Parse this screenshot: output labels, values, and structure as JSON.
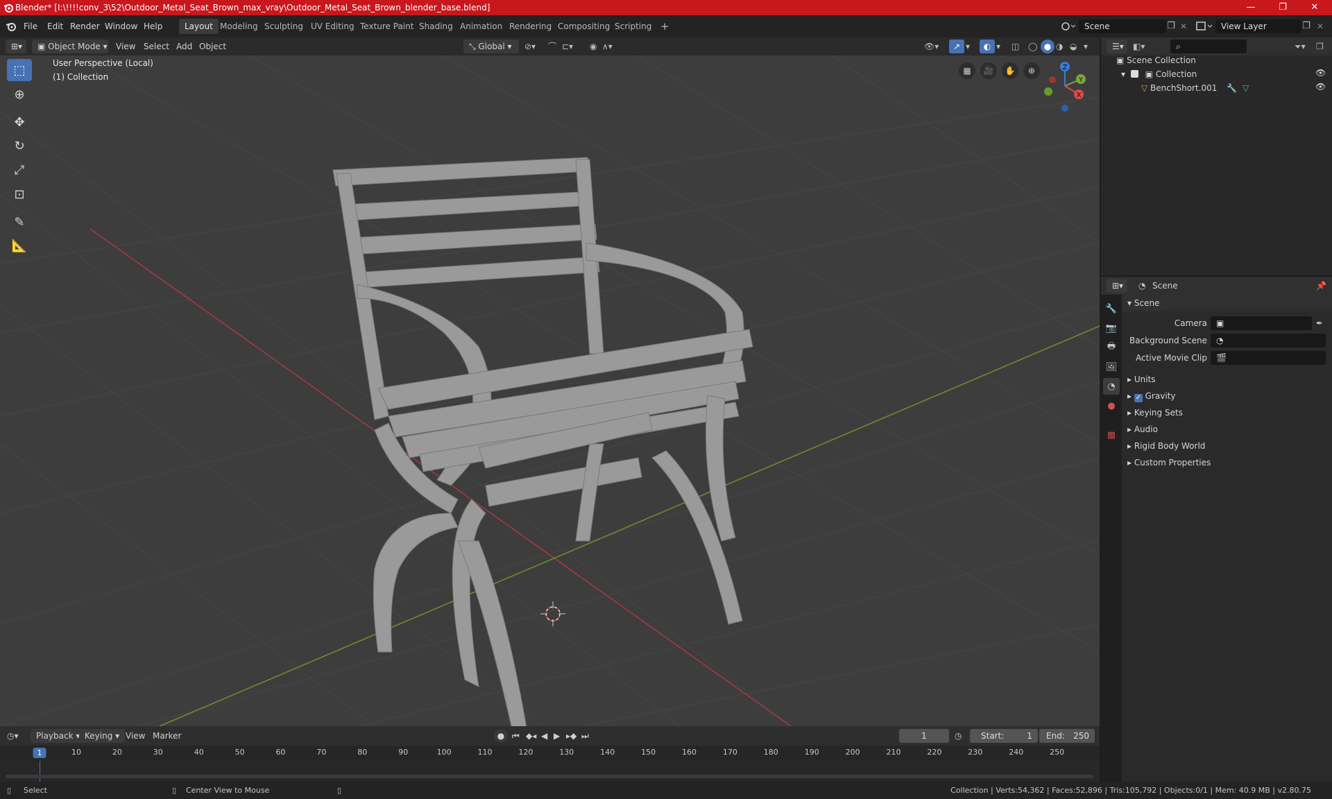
{
  "window": {
    "title": "Blender* [I:\\!!!!conv_3\\52\\Outdoor_Metal_Seat_Brown_max_vray\\Outdoor_Metal_Seat_Brown_blender_base.blend]",
    "minimize": "—",
    "maximize": "❐",
    "close": "✕"
  },
  "menu": [
    "File",
    "Edit",
    "Render",
    "Window",
    "Help"
  ],
  "workspaces": [
    "Layout",
    "Modeling",
    "Sculpting",
    "UV Editing",
    "Texture Paint",
    "Shading",
    "Animation",
    "Rendering",
    "Compositing",
    "Scripting"
  ],
  "workspace_add": "+",
  "scene_field": "Scene",
  "view_layer_field": "View Layer",
  "viewport": {
    "mode": "Object Mode",
    "menus": [
      "View",
      "Select",
      "Add",
      "Object"
    ],
    "orientation": "Global",
    "overlay_line1": "User Perspective (Local)",
    "overlay_line2": "(1) Collection",
    "gizmo_axes": [
      "Z",
      "Y",
      "X"
    ],
    "tools": [
      "select-box-icon",
      "cursor-icon",
      "move-icon",
      "rotate-icon",
      "scale-icon",
      "transform-icon",
      "annotate-icon",
      "measure-icon"
    ]
  },
  "outliner": {
    "search_placeholder": "",
    "root": "Scene Collection",
    "collection": "Collection",
    "object": "BenchShort.001"
  },
  "properties": {
    "tab_title": "Scene",
    "panel_title": "Scene",
    "camera_label": "Camera",
    "background_scene_label": "Background Scene",
    "active_movie_clip_label": "Active Movie Clip",
    "subpanels": [
      "Units",
      "Gravity",
      "Keying Sets",
      "Audio",
      "Rigid Body World",
      "Custom Properties"
    ],
    "gravity_checked": true
  },
  "timeline": {
    "menus": [
      "Playback",
      "Keying",
      "View",
      "Marker"
    ],
    "current_frame": "1",
    "start_label": "Start:",
    "start_value": "1",
    "end_label": "End:",
    "end_value": "250",
    "ruler_ticks": [
      "1",
      "10",
      "20",
      "30",
      "40",
      "50",
      "60",
      "70",
      "80",
      "90",
      "100",
      "110",
      "120",
      "130",
      "140",
      "150",
      "160",
      "170",
      "180",
      "190",
      "200",
      "210",
      "220",
      "230",
      "240",
      "250"
    ]
  },
  "status": {
    "select": "Select",
    "center": "Center View to Mouse",
    "stats": "Collection | Verts:54,362 | Faces:52,896 | Tris:105,792 | Objects:0/1 | Mem: 40.9 MB | v2.80.75"
  },
  "colors": {
    "titlebar": "#c8171d",
    "accent": "#4772b3",
    "axis_x": "#e04848",
    "axis_y": "#7aa83a",
    "axis_z": "#3d7ad6"
  }
}
